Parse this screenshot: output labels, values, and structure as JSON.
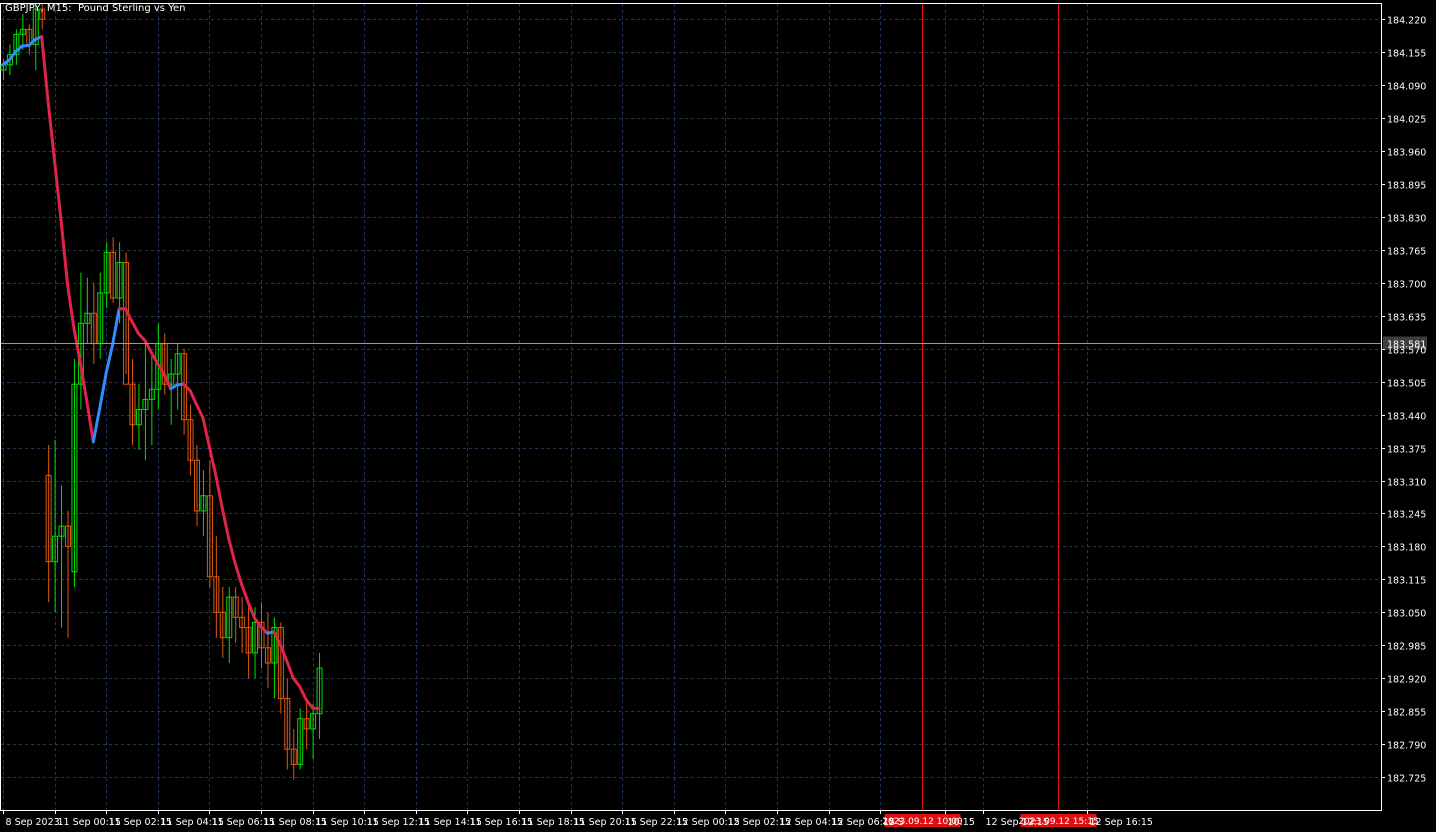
{
  "window": {
    "title": "GBPJPY, M15:  Pound Sterling vs Yen"
  },
  "colors": {
    "background": "#000000",
    "frame": "#ffffff",
    "grid": "#24345a",
    "bull": "#00e000",
    "bear": "#e05a0e",
    "ma_down": "#e0234a",
    "ma_up": "#2f8dff",
    "vline": "#e01010",
    "price_line": "#9a9a9a",
    "axis_text": "#ffffff",
    "price_label_bg": "#3e3e3e"
  },
  "chart_data": {
    "type": "candlestick",
    "symbol": "GBPJPY",
    "timeframe": "M15",
    "ylim": [
      182.66,
      184.25
    ],
    "y_ticks": [
      "184.220",
      "184.155",
      "184.090",
      "184.025",
      "183.960",
      "183.895",
      "183.830",
      "183.765",
      "183.700",
      "183.635",
      "183.570",
      "183.505",
      "183.440",
      "183.375",
      "183.310",
      "183.245",
      "183.180",
      "183.115",
      "183.050",
      "182.985",
      "182.920",
      "182.855",
      "182.790",
      "182.725"
    ],
    "x_ticks": [
      {
        "label": "8 Sep 2023",
        "i": 0
      },
      {
        "label": "11 Sep 00:15",
        "i": 8
      },
      {
        "label": "11 Sep 02:15",
        "i": 16
      },
      {
        "label": "11 Sep 04:15",
        "i": 24
      },
      {
        "label": "11 Sep 06:15",
        "i": 32
      },
      {
        "label": "11 Sep 08:15",
        "i": 40
      },
      {
        "label": "11 Sep 10:15",
        "i": 48
      },
      {
        "label": "11 Sep 12:15",
        "i": 56
      },
      {
        "label": "11 Sep 14:15",
        "i": 64
      },
      {
        "label": "11 Sep 16:15",
        "i": 72
      },
      {
        "label": "11 Sep 18:15",
        "i": 80
      },
      {
        "label": "11 Sep 20:15",
        "i": 88
      },
      {
        "label": "11 Sep 22:15",
        "i": 96
      },
      {
        "label": "12 Sep 00:15",
        "i": 104
      },
      {
        "label": "12 Sep 02:15",
        "i": 112
      },
      {
        "label": "12 Sep 04:15",
        "i": 120
      },
      {
        "label": "12 Sep 06:15",
        "i": 128
      },
      {
        "label": "12 S",
        "i": 136
      },
      {
        "label": "10:15",
        "i": 146
      },
      {
        "label": "12 Sep 12:15",
        "i": 152
      },
      {
        "label": "12 Sep 16:15",
        "i": 168
      }
    ],
    "current_price": "183.581",
    "vlines": [
      {
        "i": 142.5,
        "label": "2023.09.12 10:00"
      },
      {
        "i": 163.5,
        "label": "2023.09.12 15:15"
      }
    ],
    "candles": [
      {
        "o": 184.12,
        "h": 184.14,
        "l": 184.1,
        "c": 184.13
      },
      {
        "o": 184.13,
        "h": 184.17,
        "l": 184.11,
        "c": 184.15
      },
      {
        "o": 184.15,
        "h": 184.2,
        "l": 184.13,
        "c": 184.19
      },
      {
        "o": 184.19,
        "h": 184.23,
        "l": 184.16,
        "c": 184.2
      },
      {
        "o": 184.2,
        "h": 184.21,
        "l": 184.15,
        "c": 184.17
      },
      {
        "o": 184.17,
        "h": 184.25,
        "l": 184.12,
        "c": 184.24
      },
      {
        "o": 184.24,
        "h": 184.25,
        "l": 184.2,
        "c": 184.22
      },
      {
        "o": 183.32,
        "h": 183.38,
        "l": 183.07,
        "c": 183.15
      },
      {
        "o": 183.15,
        "h": 183.39,
        "l": 183.05,
        "c": 183.2
      },
      {
        "o": 183.2,
        "h": 183.3,
        "l": 183.02,
        "c": 183.22
      },
      {
        "o": 183.22,
        "h": 183.25,
        "l": 183.0,
        "c": 183.18
      },
      {
        "o": 183.13,
        "h": 183.55,
        "l": 183.1,
        "c": 183.5
      },
      {
        "o": 183.5,
        "h": 183.72,
        "l": 183.45,
        "c": 183.62
      },
      {
        "o": 183.62,
        "h": 183.71,
        "l": 183.58,
        "c": 183.64
      },
      {
        "o": 183.64,
        "h": 183.7,
        "l": 183.54,
        "c": 183.58
      },
      {
        "o": 183.58,
        "h": 183.72,
        "l": 183.55,
        "c": 183.68
      },
      {
        "o": 183.68,
        "h": 183.78,
        "l": 183.65,
        "c": 183.76
      },
      {
        "o": 183.76,
        "h": 183.79,
        "l": 183.66,
        "c": 183.67
      },
      {
        "o": 183.67,
        "h": 183.78,
        "l": 183.62,
        "c": 183.74
      },
      {
        "o": 183.74,
        "h": 183.76,
        "l": 183.52,
        "c": 183.5
      },
      {
        "o": 183.5,
        "h": 183.55,
        "l": 183.38,
        "c": 183.42
      },
      {
        "o": 183.42,
        "h": 183.5,
        "l": 183.37,
        "c": 183.45
      },
      {
        "o": 183.45,
        "h": 183.58,
        "l": 183.35,
        "c": 183.47
      },
      {
        "o": 183.47,
        "h": 183.56,
        "l": 183.38,
        "c": 183.49
      },
      {
        "o": 183.49,
        "h": 183.62,
        "l": 183.45,
        "c": 183.58
      },
      {
        "o": 183.58,
        "h": 183.6,
        "l": 183.48,
        "c": 183.5
      },
      {
        "o": 183.5,
        "h": 183.55,
        "l": 183.42,
        "c": 183.52
      },
      {
        "o": 183.52,
        "h": 183.58,
        "l": 183.45,
        "c": 183.56
      },
      {
        "o": 183.56,
        "h": 183.57,
        "l": 183.4,
        "c": 183.43
      },
      {
        "o": 183.43,
        "h": 183.46,
        "l": 183.32,
        "c": 183.35
      },
      {
        "o": 183.35,
        "h": 183.38,
        "l": 183.22,
        "c": 183.25
      },
      {
        "o": 183.25,
        "h": 183.33,
        "l": 183.2,
        "c": 183.28
      },
      {
        "o": 183.28,
        "h": 183.35,
        "l": 183.1,
        "c": 183.12
      },
      {
        "o": 183.12,
        "h": 183.2,
        "l": 183.0,
        "c": 183.05
      },
      {
        "o": 183.05,
        "h": 183.1,
        "l": 182.96,
        "c": 183.0
      },
      {
        "o": 183.0,
        "h": 183.1,
        "l": 182.95,
        "c": 183.08
      },
      {
        "o": 183.08,
        "h": 183.1,
        "l": 182.99,
        "c": 183.04
      },
      {
        "o": 183.04,
        "h": 183.08,
        "l": 182.97,
        "c": 183.02
      },
      {
        "o": 183.02,
        "h": 183.07,
        "l": 182.92,
        "c": 182.97
      },
      {
        "o": 182.97,
        "h": 183.06,
        "l": 182.92,
        "c": 183.03
      },
      {
        "o": 183.03,
        "h": 183.07,
        "l": 182.94,
        "c": 182.98
      },
      {
        "o": 182.98,
        "h": 183.05,
        "l": 182.9,
        "c": 182.95
      },
      {
        "o": 182.95,
        "h": 183.04,
        "l": 182.88,
        "c": 183.02
      },
      {
        "o": 183.02,
        "h": 183.03,
        "l": 182.85,
        "c": 182.88
      },
      {
        "o": 182.88,
        "h": 182.92,
        "l": 182.74,
        "c": 182.78
      },
      {
        "o": 182.78,
        "h": 182.82,
        "l": 182.72,
        "c": 182.75
      },
      {
        "o": 182.75,
        "h": 182.86,
        "l": 182.74,
        "c": 182.84
      },
      {
        "o": 182.84,
        "h": 182.88,
        "l": 182.78,
        "c": 182.82
      },
      {
        "o": 182.82,
        "h": 182.87,
        "l": 182.76,
        "c": 182.85
      },
      {
        "o": 182.85,
        "h": 182.97,
        "l": 182.8,
        "c": 182.94
      }
    ]
  }
}
